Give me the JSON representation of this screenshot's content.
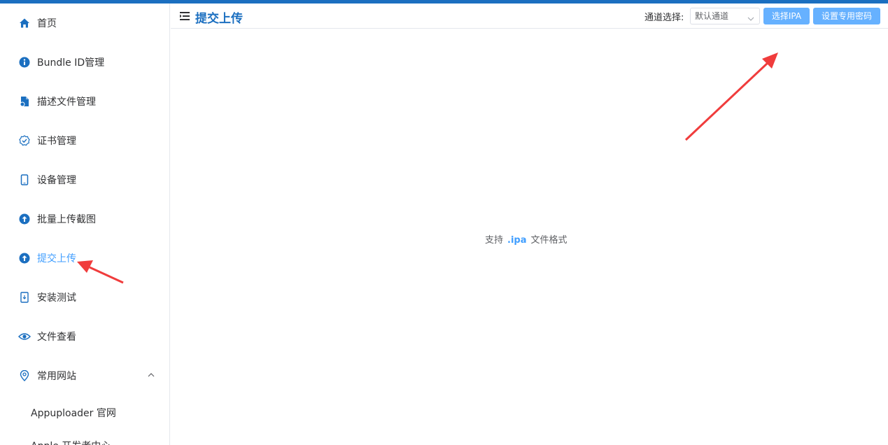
{
  "sidebar": {
    "items": [
      {
        "label": "首页",
        "icon": "home-icon"
      },
      {
        "label": "Bundle ID管理",
        "icon": "info-icon"
      },
      {
        "label": "描述文件管理",
        "icon": "file-icon"
      },
      {
        "label": "证书管理",
        "icon": "certificate-icon"
      },
      {
        "label": "设备管理",
        "icon": "device-icon"
      },
      {
        "label": "批量上传截图",
        "icon": "upload-icon"
      },
      {
        "label": "提交上传",
        "icon": "upload-icon",
        "active": true
      },
      {
        "label": "安装测试",
        "icon": "install-icon"
      },
      {
        "label": "文件查看",
        "icon": "eye-icon"
      },
      {
        "label": "常用网站",
        "icon": "location-icon",
        "expanded": true
      }
    ],
    "sub_items": [
      {
        "label": "Appuploader 官网"
      },
      {
        "label": "Apple 开发者中心"
      }
    ]
  },
  "header": {
    "title": "提交上传",
    "channel_label": "通道选择:",
    "channel_value": "默认通道",
    "select_ipa_label": "选择IPA",
    "set_password_label": "设置专用密码"
  },
  "main": {
    "support_prefix": "支持",
    "support_ext": ".ipa",
    "support_suffix": "文件格式"
  },
  "colors": {
    "brand": "#1b6fc0",
    "accent": "#409eff",
    "button": "#66b1ff",
    "annotation_arrow": "#f03c3c"
  }
}
